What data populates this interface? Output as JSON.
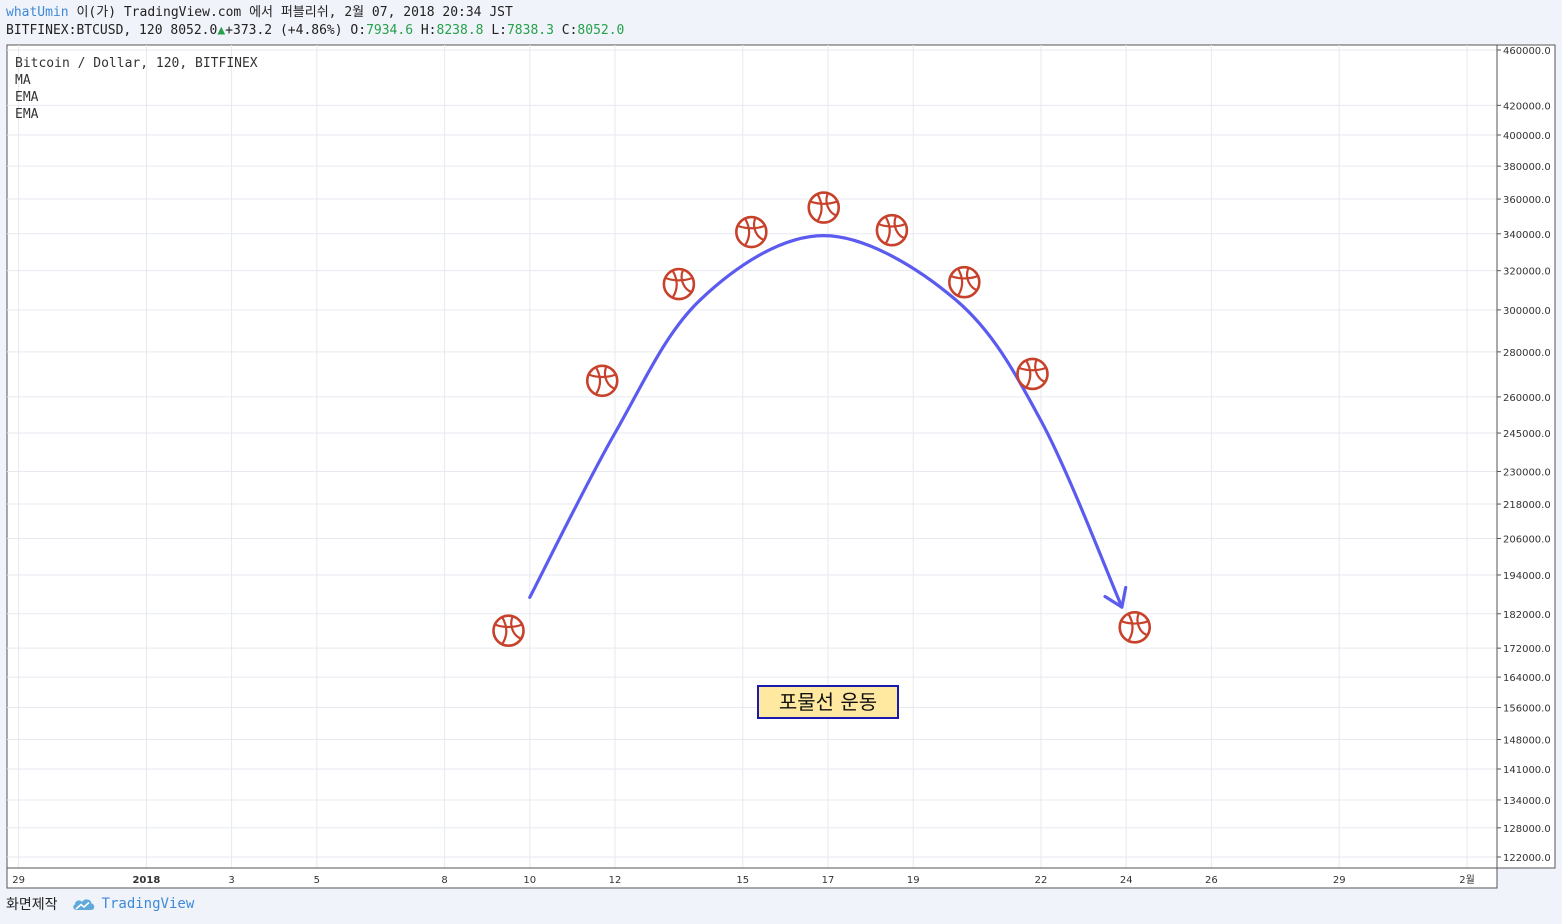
{
  "header": {
    "author": "whatUmin",
    "publish_text": "이(가) TradingView.com 에서 퍼블리쉬, 2월 07, 2018 20:34 JST",
    "symbol": "BITFINEX:BTCUSD, 120",
    "last": "8052.0",
    "change": "+373.2 (+4.86%)",
    "o_label": "O:",
    "o_value": "7934.6",
    "h_label": "H:",
    "h_value": "8238.8",
    "l_label": "L:",
    "l_value": "7838.3",
    "c_label": "C:",
    "c_value": "8052.0"
  },
  "legend": {
    "title": "Bitcoin / Dollar, 120, BITFINEX",
    "indicators": [
      "MA",
      "EMA",
      "EMA"
    ]
  },
  "annotation": {
    "label": "포물선 운동"
  },
  "footer": {
    "made_by": "화면제작",
    "brand": "TradingView"
  },
  "colors": {
    "arrow": "#5b5bf0",
    "ball": "#c8412a",
    "label_bg": "#ffe9a0",
    "label_border": "#1a1ab0",
    "grid": "#e6eaf0"
  },
  "chart_data": {
    "type": "line",
    "x_ticks": [
      {
        "label": "29",
        "t": -13.5
      },
      {
        "label": "2018",
        "t": -10.5
      },
      {
        "label": "3",
        "t": -8.5
      },
      {
        "label": "5",
        "t": -6.5
      },
      {
        "label": "8",
        "t": -3.5
      },
      {
        "label": "10",
        "t": -1.5
      },
      {
        "label": "12",
        "t": 0.5
      },
      {
        "label": "15",
        "t": 3.5
      },
      {
        "label": "17",
        "t": 5.5
      },
      {
        "label": "19",
        "t": 7.5
      },
      {
        "label": "22",
        "t": 10.5
      },
      {
        "label": "24",
        "t": 12.5
      },
      {
        "label": "26",
        "t": 14.5
      },
      {
        "label": "29",
        "t": 17.5
      },
      {
        "label": "2월",
        "t": 20.5
      }
    ],
    "y_ticks": [
      460000,
      420000,
      400000,
      380000,
      360000,
      340000,
      320000,
      300000,
      280000,
      260000,
      245000,
      230000,
      218000,
      206000,
      194000,
      182000,
      172000,
      164000,
      156000,
      148000,
      141000,
      134000,
      128000,
      122000
    ],
    "y_log": true,
    "arrow_path": [
      {
        "t": -1.5,
        "y": 187000
      },
      {
        "t": 0.5,
        "y": 245000
      },
      {
        "t": 2.5,
        "y": 305000
      },
      {
        "t": 5.4,
        "y": 339000
      },
      {
        "t": 8.5,
        "y": 305000
      },
      {
        "t": 10.5,
        "y": 250000
      },
      {
        "t": 12.4,
        "y": 184000
      }
    ],
    "balls": [
      {
        "t": -2.0,
        "y": 177000
      },
      {
        "t": 0.2,
        "y": 267000
      },
      {
        "t": 2.0,
        "y": 313000
      },
      {
        "t": 3.7,
        "y": 341000
      },
      {
        "t": 5.4,
        "y": 355000
      },
      {
        "t": 7.0,
        "y": 342000
      },
      {
        "t": 8.7,
        "y": 314000
      },
      {
        "t": 10.3,
        "y": 270000
      },
      {
        "t": 12.7,
        "y": 178000
      }
    ],
    "grid": true,
    "legend_position": "top-left"
  }
}
